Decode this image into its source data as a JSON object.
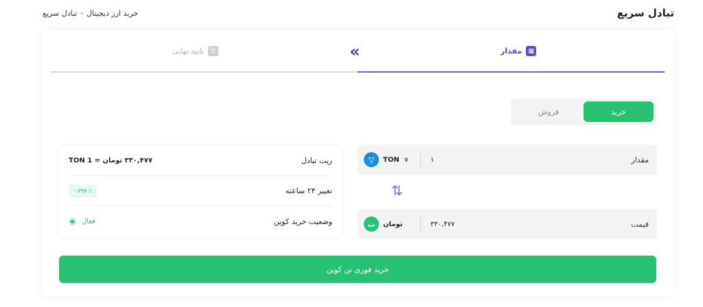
{
  "header": {
    "title": "تبادل سریع",
    "breadcrumb": [
      "خرید ارز دیجیتال",
      "تبادل سریع"
    ],
    "breadcrumb_sep": "«"
  },
  "steps": {
    "active": {
      "label": "مقدار",
      "icon": "calculator-icon"
    },
    "inactive": {
      "label": "تایید نهایی",
      "icon": "checklist-icon"
    },
    "arrow": "«"
  },
  "toggle": {
    "buy": "خرید",
    "sell": "فروش"
  },
  "info": {
    "rate_label": "ریت تبادل",
    "rate_value": "۳۳۰,۴۷۷ تومان = 1 TON",
    "change_label": "تغییر ۲۴ ساعته",
    "change_value": "٪ ۰.۳۹۷",
    "status_label": "وضعیت خرید کوین",
    "status_value": "فعال"
  },
  "amount": {
    "label": "مقدار",
    "value": "۱",
    "coin": "TON",
    "coin_icon": "ton-icon",
    "chevron": "∨"
  },
  "price": {
    "label": "قیمت",
    "value": "۳۳۰,۴۷۷",
    "coin": "تومان",
    "coin_icon": "toman-icon",
    "coin_glyph": "ت"
  },
  "swap_icon": "⇅",
  "submit": {
    "label": "خرید فوری تن کوین"
  },
  "colors": {
    "accent": "#5b4ccf",
    "green": "#27c172"
  }
}
